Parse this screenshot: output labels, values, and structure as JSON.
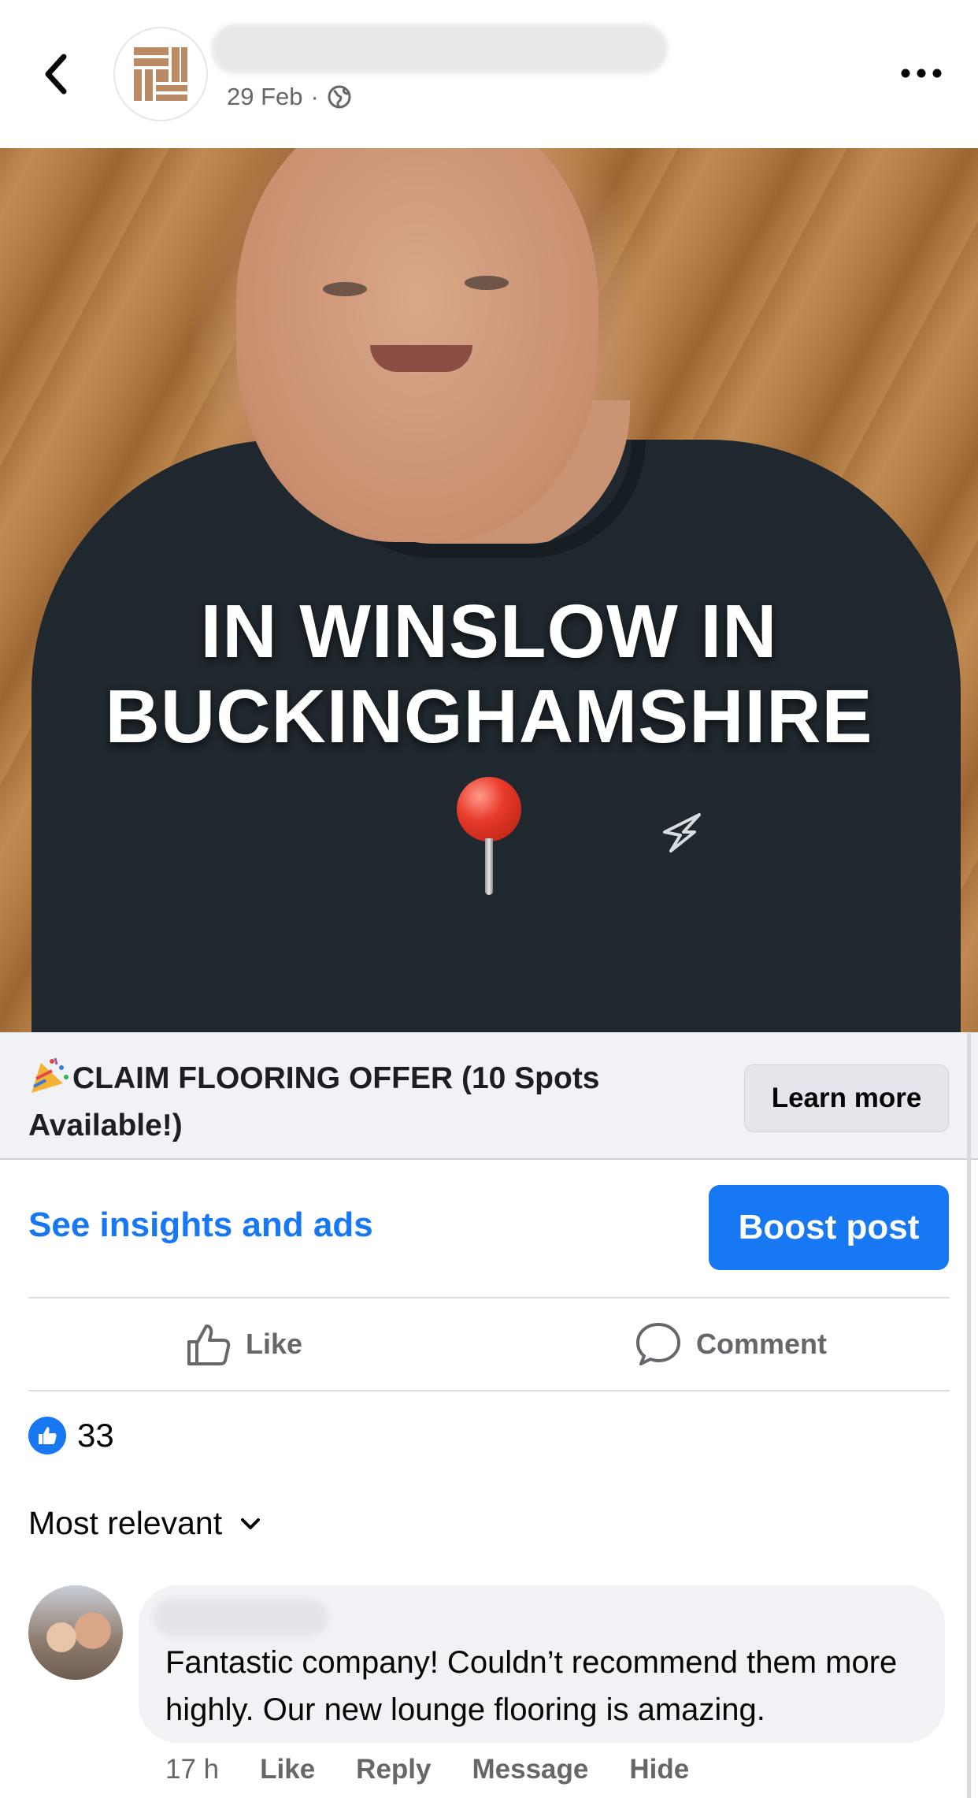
{
  "header": {
    "date": "29 Feb",
    "separator": "·",
    "audience_icon": "globe-icon",
    "back_icon": "chevron-left-icon",
    "more_icon": "ellipsis-icon"
  },
  "video": {
    "caption_line1": "IN WINSLOW IN",
    "caption_line2": "BUCKINGHAMSHIRE",
    "mute_icon": "speaker-muted-icon"
  },
  "cta": {
    "text_line1": "CLAIM FLOORING OFFER (10 Spots",
    "text_line2": "Available!)",
    "emoji_icon": "party-popper-icon",
    "button_label": "Learn more"
  },
  "insights": {
    "link_label": "See insights and ads",
    "boost_label": "Boost post"
  },
  "actions": {
    "like_label": "Like",
    "comment_label": "Comment"
  },
  "reactions": {
    "count": "33"
  },
  "comments": {
    "sort_label": "Most relevant",
    "items": [
      {
        "text": "Fantastic company!  Couldn’t recommend them more highly.  Our new lounge flooring is amazing.",
        "time": "17 h",
        "like": "Like",
        "reply": "Reply",
        "message": "Message",
        "hide": "Hide"
      }
    ]
  },
  "colors": {
    "accent": "#1877f2",
    "secondary_text": "#65676b",
    "cta_background": "#f0f2f5"
  }
}
